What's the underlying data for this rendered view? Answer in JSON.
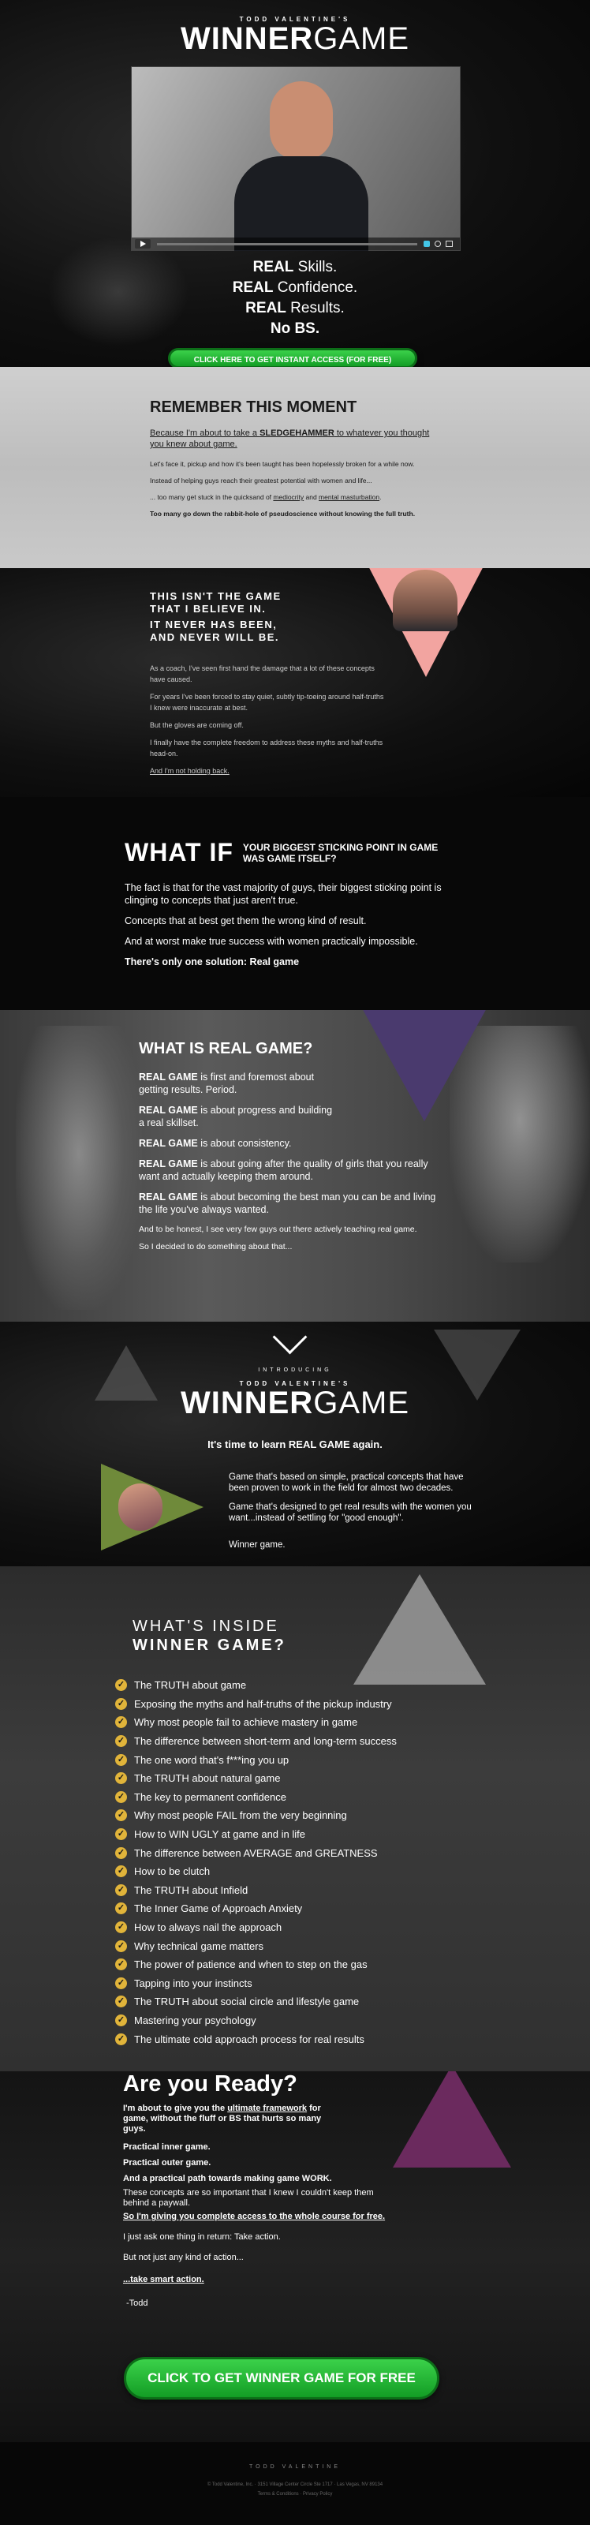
{
  "brand": {
    "small": "TODD VALENTINE'S",
    "bold": "WINNER",
    "light": "GAME"
  },
  "hero": {
    "lines": [
      {
        "strong": "REAL",
        "rest": " Skills."
      },
      {
        "strong": "REAL",
        "rest": " Confidence."
      },
      {
        "strong": "REAL",
        "rest": " Results."
      }
    ],
    "no_bs": "No BS.",
    "cta": "CLICK HERE TO GET INSTANT ACCESS (FOR FREE)"
  },
  "video": {
    "play_icon": "play-icon",
    "control_icons": [
      "volume-icon",
      "settings-icon",
      "fullscreen-icon"
    ]
  },
  "remember": {
    "title": "REMEMBER THIS MOMENT",
    "lead_a": "Because I'm about to take a ",
    "lead_b": "SLEDGEHAMMER",
    "lead_c": " to whatever you thought you knew about game.",
    "p1": "Let's face it, pickup and how it's been taught has been hopelessly broken for a while now.",
    "p2": "Instead of helping guys reach their greatest potential with women and life...",
    "p3a": "... too many get stuck in the quicksand of ",
    "p3b": "mediocrity",
    "p3c": " and ",
    "p3d": "mental masturbation",
    "p3e": ".",
    "p4": "Too many go down the rabbit-hole of pseudoscience without knowing the full truth."
  },
  "believe": {
    "h1": "THIS ISN'T THE GAME",
    "h2": "THAT I BELIEVE IN.",
    "h3": "IT NEVER HAS BEEN,",
    "h4": "AND NEVER WILL BE.",
    "p1": "As a coach, I've seen first hand the damage that a lot of these concepts have caused.",
    "p2": "For years I've been forced to stay quiet, subtly tip-toeing around half-truths I knew were inaccurate at best.",
    "p3": "But the gloves are coming off.",
    "p4": "I finally have the complete freedom to address these myths and half-truths head-on.",
    "p5": "And I'm not holding back."
  },
  "whatif": {
    "big": "WHAT IF",
    "side1": "YOUR BIGGEST STICKING POINT IN GAME",
    "side2": "WAS GAME ITSELF?",
    "p1": "The fact is that for the vast majority of guys, their biggest sticking point is clinging to concepts that just aren't true.",
    "p2": "Concepts that at best get them the wrong kind of result.",
    "p3": "And at worst make true success with women practically impossible.",
    "p4": "There's only one solution: Real game"
  },
  "realgame": {
    "title": "WHAT IS REAL GAME?",
    "items": [
      {
        "b": "REAL GAME",
        "t": " is first and foremost about getting results. Period."
      },
      {
        "b": "REAL GAME",
        "t": " is about progress and building a real skillset."
      },
      {
        "b": "REAL GAME",
        "t": " is about consistency."
      },
      {
        "b": "REAL GAME",
        "t": " is about going after the quality of girls that you really want and actually keeping them around."
      },
      {
        "b": "REAL GAME",
        "t": " is about becoming the best man you can be and living the life you've always wanted."
      }
    ],
    "p1": "And to be honest, I see very few guys out there actively teaching real game.",
    "p2": "So I decided to do something about that..."
  },
  "introducing": {
    "label": "INTRODUCING",
    "tagline": "It's time to learn REAL GAME again.",
    "p1": "Game that's based on simple, practical concepts that have been proven to work in the field for almost two decades.",
    "p2": "Game that's designed to get real results with the women you want...instead of settling for \"good enough\".",
    "p3": "Winner game."
  },
  "inside": {
    "title1": "WHAT'S INSIDE",
    "title2": "WINNER GAME?",
    "items": [
      "The TRUTH about game",
      "Exposing the myths and half-truths of the pickup industry",
      "Why most people fail to achieve mastery in game",
      "The difference between short-term and long-term success",
      "The one word that's f***ing you up",
      "The TRUTH about natural game",
      "The key to permanent confidence",
      "Why most people FAIL from the very beginning",
      "How to WIN UGLY at game and in life",
      "The difference between AVERAGE and GREATNESS",
      "How to be clutch",
      "The TRUTH about Infield",
      "The Inner Game of Approach Anxiety",
      "How to always nail the approach",
      "Why technical game matters",
      "The power of patience and when to step on the gas",
      "Tapping into your instincts",
      "The TRUTH about social circle and lifestyle game",
      "Mastering your psychology",
      "The ultimate cold approach process for real results"
    ]
  },
  "ready": {
    "title": "Are you Ready?",
    "lead_a": "I'm about to give you the ",
    "lead_b": "ultimate framework",
    "lead_c": " for game, without the fluff or BS that hurts so many guys.",
    "l1": "Practical inner game.",
    "l2": "Practical outer game.",
    "l3": "And a practical path towards making game WORK.",
    "l4": "These concepts are so important that I knew I couldn't keep them behind a paywall.",
    "l5": "So I'm giving you complete access to the whole course for free.",
    "l6": "I just ask one thing in return: Take action.",
    "l7": "But not just any kind of action...",
    "l8": "...take smart action.",
    "sign": "-Todd",
    "cta": "CLICK TO GET WINNER GAME FOR FREE"
  },
  "footer": {
    "brand": "TODD VALENTINE",
    "address": "© Todd Valentine, Inc. · 3151 Village Center Circle Ste 1717 · Las Vegas, NV 89134",
    "links": "Terms & Conditions · Privacy Policy"
  }
}
